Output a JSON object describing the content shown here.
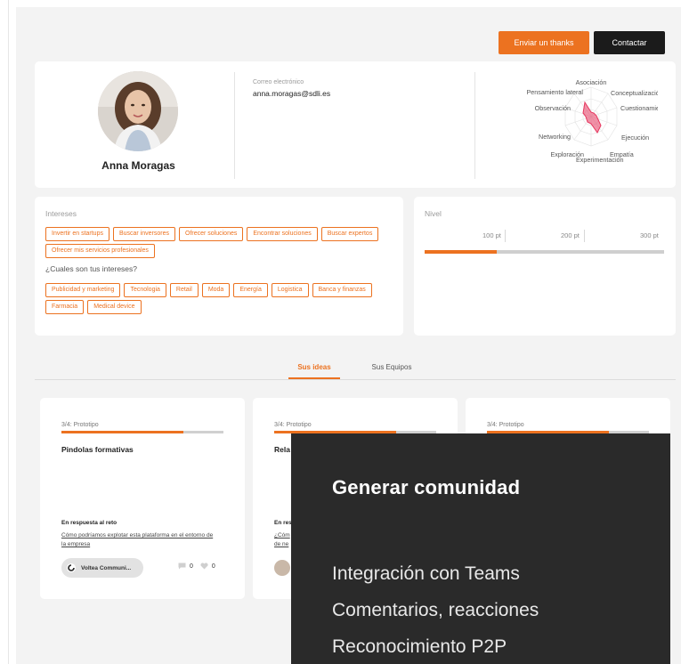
{
  "actions": {
    "thanks_label": "Enviar un thanks",
    "contact_label": "Contactar"
  },
  "profile": {
    "name": "Anna Moragas",
    "email_label": "Correo electrónico",
    "email": "anna.moragas@sdli.es",
    "skills_radar": {
      "labels": [
        "Asociación",
        "Conceptualización",
        "Cuestionamiento",
        "Ejecución",
        "Empatía",
        "Experimentación",
        "Exploración",
        "Networking",
        "Observación",
        "Pensamiento lateral"
      ]
    }
  },
  "interests": {
    "title": "Intereses",
    "tags": [
      "Invertir en startups",
      "Buscar inversores",
      "Ofrecer soluciones",
      "Encontrar soluciones",
      "Buscar expertos",
      "Ofrecer mis servicios profesionales"
    ],
    "question": "¿Cuales son tus intereses?",
    "sector_tags": [
      "Publicidad y marketing",
      "Tecnologia",
      "Retail",
      "Moda",
      "Energía",
      "Logistica",
      "Banca y finanzas",
      "Farmacia",
      "Medical device"
    ]
  },
  "level": {
    "title": "Nivel",
    "ticks": [
      "100 pt",
      "200 pt",
      "300 pt"
    ],
    "progress_percent": 30
  },
  "tabs": {
    "ideas": "Sus ideas",
    "teams": "Sus Equipos"
  },
  "ideas": [
    {
      "phase": "3/4: Prototipo",
      "progress_percent": 75,
      "title": "Pindolas formativas",
      "response_label": "En respuesta al reto",
      "response_link": "Cómo podríamos explotar esta plataforma en el entorno de la empresa",
      "team": "Voltea Communi...",
      "comments": "0",
      "likes": "0"
    },
    {
      "phase": "3/4: Prototipo",
      "progress_percent": 75,
      "title": "Rela",
      "response_label": "En res",
      "response_link": "¿Cóm de ne"
    },
    {
      "phase": "3/4: Prototipo",
      "progress_percent": 75
    }
  ],
  "overlay": {
    "title": "Generar comunidad",
    "items": [
      "Integración con Teams",
      "Comentarios, reacciones",
      "Reconocimiento P2P"
    ]
  },
  "colors": {
    "accent": "#ec7220",
    "dark": "#1b1b1b",
    "radar": "#e6375f"
  }
}
